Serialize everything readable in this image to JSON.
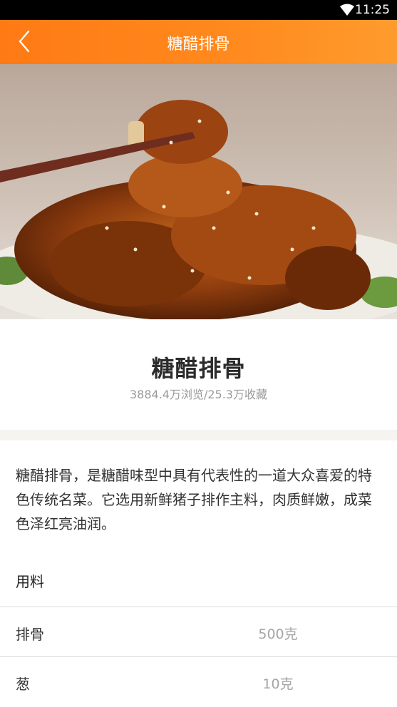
{
  "status_bar": {
    "time": "11:25"
  },
  "app_bar": {
    "title": "糖醋排骨"
  },
  "dish": {
    "title": "糖醋排骨",
    "stats": "3884.4万浏览/25.3万收藏",
    "description": "糖醋排骨，是糖醋味型中具有代表性的一道大众喜爱的特色传统名菜。它选用新鲜猪子排作主料，肉质鲜嫩，成菜色泽红亮油润。"
  },
  "ingredients": {
    "label": "用料",
    "items": [
      {
        "name": "排骨",
        "amount": "500克"
      },
      {
        "name": "葱",
        "amount": "10克"
      }
    ]
  },
  "colors": {
    "accent": "#ff7f1a",
    "muted_text": "#9a9a9a"
  }
}
